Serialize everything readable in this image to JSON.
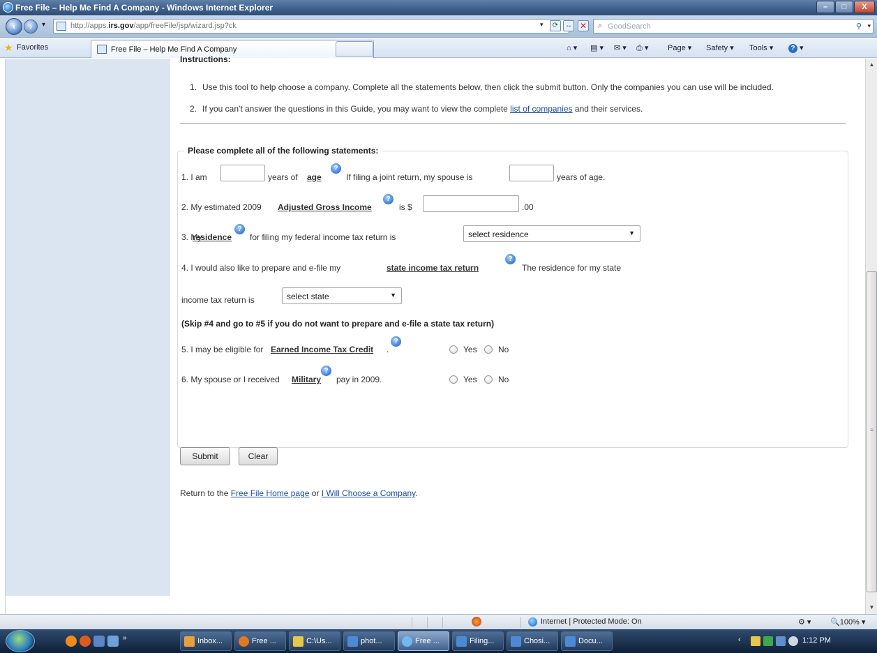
{
  "window": {
    "title": "Free File – Help Me Find A Company - Windows Internet Explorer",
    "btn_min": "–",
    "btn_max": "□",
    "btn_close": "X"
  },
  "navbar": {
    "url_prefix": "http://apps.",
    "url_domain": "irs.gov",
    "url_path": "/app/freeFile/jsp/wizard.jsp?ck",
    "search_placeholder": "GoodSearch"
  },
  "favbar": {
    "favorites_label": "Favorites",
    "tab_label": "Free File – Help Me Find A Company",
    "commands": {
      "page": "Page ▾",
      "safety": "Safety ▾",
      "tools": "Tools ▾"
    }
  },
  "content": {
    "instructions_heading": "Instructions:",
    "instructions": [
      {
        "num": "1.",
        "text": "Use this tool to help choose a company. Complete all the statements below, then click the submit button. Only the companies you can use will be included."
      },
      {
        "num": "2.",
        "text_before": "If you can't answer the questions in this Guide, you may want to view the complete ",
        "link": "list of companies",
        "text_after": " and their services."
      }
    ],
    "form": {
      "legend": "Please complete all of the following statements:",
      "s1": {
        "a": "1. I am",
        "b": "years of",
        "link": "age",
        "c": "If filing a joint return, my spouse is",
        "d": "years of age."
      },
      "s2": {
        "a": "2. My estimated 2009",
        "link": "Adjusted Gross Income",
        "b": "is $",
        "c": ".00"
      },
      "s3": {
        "a": "3. My",
        "link": "residence",
        "b": "for filing my federal income tax return is",
        "select": "select residence"
      },
      "s4": {
        "a": "4. I would also like to prepare and e-file my",
        "link": "state income tax return",
        "b": "The residence for my state",
        "c": "income tax return is",
        "select": "select state"
      },
      "skip_note": "(Skip #4 and go to #5 if you do not want to prepare and e-file a state tax return)",
      "s5": {
        "a": "5. I may be eligible for",
        "link": "Earned Income Tax Credit",
        "b": "."
      },
      "s6": {
        "a": "6. My spouse or I received",
        "link": "Military",
        "b": "pay in 2009."
      },
      "yes": "Yes",
      "no": "No"
    },
    "buttons": {
      "submit": "Submit",
      "clear": "Clear"
    },
    "return_line": {
      "a": "Return to the ",
      "link1": "Free File Home page",
      "b": " or ",
      "link2": "I Will Choose a Company",
      "c": "."
    }
  },
  "statusbar": {
    "zone": "Internet | Protected Mode: On",
    "zoom": "100%"
  },
  "taskbar": {
    "tasks": [
      "Inbox...",
      "Free ...",
      "C:\\Us...",
      "phot...",
      "Free ...",
      "Filing...",
      "Chosi...",
      "Docu..."
    ],
    "clock": "1:12 PM"
  },
  "colors": {
    "link": "#1a4fa3",
    "sidebar": "#dbe5f1",
    "titlebar": "#3c5f8a"
  }
}
